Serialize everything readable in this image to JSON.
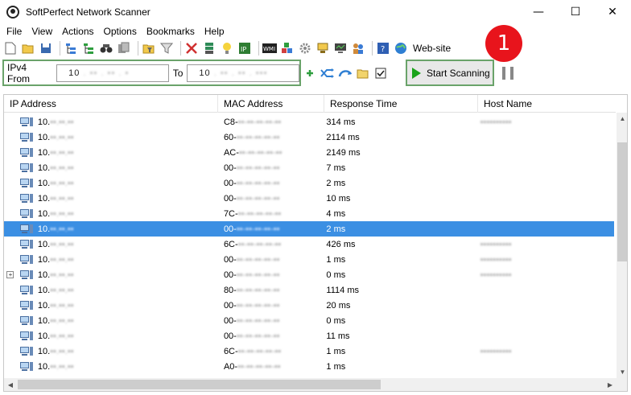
{
  "window": {
    "title": "SoftPerfect Network Scanner",
    "controls": [
      "—",
      "☐",
      "✕"
    ]
  },
  "menu": [
    "File",
    "View",
    "Actions",
    "Options",
    "Bookmarks",
    "Help"
  ],
  "toolbar": {
    "website_label": "Web-site"
  },
  "range": {
    "label": "IPv4 From",
    "from_value": "10",
    "from_rest": ". ▪▪ . ▪▪ . ▪",
    "to_label": "To",
    "to_value": "10",
    "to_rest": ". ▪▪ . ▪▪ . ▪▪▪"
  },
  "scan_button": {
    "label": "Start Scanning"
  },
  "badge": "1",
  "columns": [
    "IP Address",
    "MAC Address",
    "Response Time",
    "Host Name"
  ],
  "rows": [
    {
      "ip": "10.",
      "mac": "C8-",
      "rt": "314 ms",
      "host": "blurred"
    },
    {
      "ip": "10.",
      "mac": "60-",
      "rt": "2114 ms",
      "host": ""
    },
    {
      "ip": "10.",
      "mac": "AC-",
      "rt": "2149 ms",
      "host": ""
    },
    {
      "ip": "10.",
      "mac": "00-",
      "rt": "7 ms",
      "host": ""
    },
    {
      "ip": "10.",
      "mac": "00-",
      "rt": "2 ms",
      "host": ""
    },
    {
      "ip": "10.",
      "mac": "00-",
      "rt": "10 ms",
      "host": ""
    },
    {
      "ip": "10.",
      "mac": "7C-",
      "rt": "4 ms",
      "host": ""
    },
    {
      "ip": "10.",
      "mac": "00-",
      "rt": "2 ms",
      "host": "",
      "selected": true
    },
    {
      "ip": "10.",
      "mac": "6C-",
      "rt": "426 ms",
      "host": "blurred"
    },
    {
      "ip": "10.",
      "mac": "00-",
      "rt": "1 ms",
      "host": "blurred"
    },
    {
      "ip": "10.",
      "mac": "00-",
      "rt": "0 ms",
      "host": "blurred",
      "expander": true
    },
    {
      "ip": "10.",
      "mac": "80-",
      "rt": "1114 ms",
      "host": ""
    },
    {
      "ip": "10.",
      "mac": "00-",
      "rt": "20 ms",
      "host": ""
    },
    {
      "ip": "10.",
      "mac": "00-",
      "rt": "0 ms",
      "host": ""
    },
    {
      "ip": "10.",
      "mac": "00-",
      "rt": "11 ms",
      "host": ""
    },
    {
      "ip": "10.",
      "mac": "6C-",
      "rt": "1 ms",
      "host": "blurred"
    },
    {
      "ip": "10.",
      "mac": "A0-",
      "rt": "1 ms",
      "host": ""
    }
  ],
  "blur": {
    "ip": "▪▪.▪▪.▪▪",
    "mac": "▪▪-▪▪-▪▪-▪▪-▪▪",
    "host": "▪▪▪▪▪▪▪▪▪▪"
  },
  "icons": {
    "toolbar1": [
      "new-icon",
      "open-icon",
      "save-icon",
      "sep",
      "tree-add-icon",
      "tree-expand-icon",
      "find-icon",
      "copy-icon",
      "sep",
      "filter-folder-icon",
      "filter-icon",
      "sep",
      "tools-icon",
      "server-icon",
      "bulb-icon",
      "ip-icon",
      "sep",
      "wmi-icon",
      "registry-icon",
      "gear-icon",
      "computer-icon",
      "monitor-icon",
      "users-icon",
      "sep",
      "help-icon",
      "globe-icon"
    ],
    "toolbar2": [
      "add-plus-icon",
      "shuffle-icon",
      "refresh-icon",
      "folder-icon",
      "checkbox-icon"
    ]
  },
  "colors": {
    "selection": "#3b8fe3",
    "highlight_border": "#6aa36a",
    "badge": "#e8141c",
    "play": "#1aa31a"
  }
}
